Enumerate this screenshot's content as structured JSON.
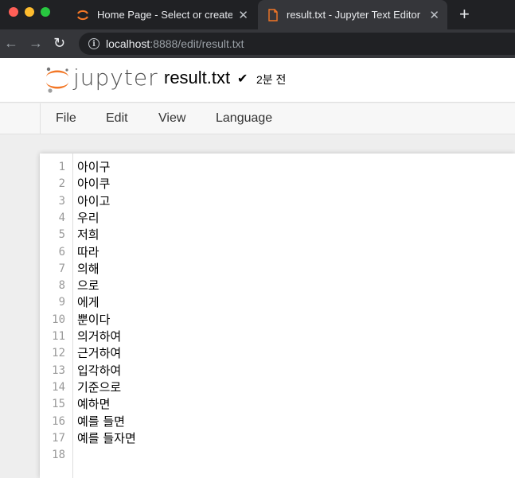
{
  "browser": {
    "tabs": [
      {
        "title": "Home Page - Select or create a",
        "active": false
      },
      {
        "title": "result.txt - Jupyter Text Editor",
        "active": true
      }
    ],
    "new_tab": "+",
    "close_glyph": "✕",
    "url_host": "localhost",
    "url_rest": ":8888/edit/result.txt",
    "info_glyph": "i",
    "back_glyph": "←",
    "forward_glyph": "→",
    "reload_glyph": "↻"
  },
  "header": {
    "logo_text": "jupyter",
    "filename": "result.txt",
    "check_glyph": "✔",
    "saved_status": "2분 전"
  },
  "menu": {
    "items": [
      "File",
      "Edit",
      "View",
      "Language"
    ]
  },
  "editor": {
    "lines": [
      {
        "num": "1",
        "text": "아이구"
      },
      {
        "num": "2",
        "text": "아이쿠"
      },
      {
        "num": "3",
        "text": "아이고"
      },
      {
        "num": "4",
        "text": "우리"
      },
      {
        "num": "5",
        "text": "저희"
      },
      {
        "num": "6",
        "text": "따라"
      },
      {
        "num": "7",
        "text": "의해"
      },
      {
        "num": "8",
        "text": "으로"
      },
      {
        "num": "9",
        "text": "에게"
      },
      {
        "num": "10",
        "text": "뿐이다"
      },
      {
        "num": "11",
        "text": "의거하여"
      },
      {
        "num": "12",
        "text": "근거하여"
      },
      {
        "num": "13",
        "text": "입각하여"
      },
      {
        "num": "14",
        "text": "기준으로"
      },
      {
        "num": "15",
        "text": "예하면"
      },
      {
        "num": "16",
        "text": "예를 들면"
      },
      {
        "num": "17",
        "text": "예를 들자면"
      },
      {
        "num": "18",
        "text": ""
      }
    ]
  },
  "colors": {
    "jupyter_orange": "#f37726",
    "tab_bar": "#202124",
    "active_tab": "#35363a"
  }
}
